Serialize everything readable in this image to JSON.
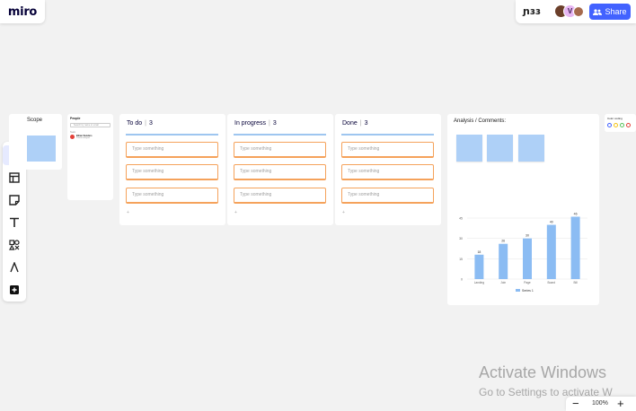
{
  "app": {
    "logo": "miro"
  },
  "top_bar": {
    "reactions": "ɲɜɜ",
    "avatar_initial": "V",
    "share_label": "Share"
  },
  "frames": {
    "scope": {
      "title": "Scope"
    },
    "people": {
      "title": "People",
      "search_placeholder": "Search by name or email",
      "subheading": "Team",
      "member_name": "Ethan Sanders",
      "member_role": "Product designer"
    },
    "columns": [
      {
        "title": "To do",
        "count": "3",
        "tasks": [
          "Type something",
          "Type something",
          "Type something"
        ],
        "add": "+"
      },
      {
        "title": "In progress",
        "count": "3",
        "tasks": [
          "Type something",
          "Type something",
          "Type something"
        ],
        "add": "+"
      },
      {
        "title": "Done",
        "count": "3",
        "tasks": [
          "Type something",
          "Type something",
          "Type something"
        ],
        "add": "+"
      }
    ],
    "analysis": {
      "title": "Analysis / Comments:"
    },
    "color_coding": {
      "title": "Color coding"
    }
  },
  "colors": {
    "accent": "#4262ff",
    "sticky": "#aed0f7",
    "task_border": "#f5a25b",
    "bar": "#8bbcf3",
    "dots": [
      "#4262ff",
      "#f5c518",
      "#58c25c",
      "#e3413a"
    ]
  },
  "chart_data": {
    "type": "bar",
    "categories": [
      "Landing",
      "Join",
      "Page",
      "Board",
      "Bill"
    ],
    "series": [
      {
        "name": "Series 1",
        "values": [
          18,
          26,
          30,
          40,
          46
        ]
      }
    ],
    "data_labels": [
      "18",
      "26",
      "30",
      "40",
      "46"
    ],
    "yticks": [
      "0",
      "15",
      "30",
      "45"
    ],
    "ylim": [
      0,
      45
    ],
    "legend": "bottom",
    "grid": true
  },
  "zoom": {
    "minus": "−",
    "value": "100%",
    "plus": "+"
  },
  "watermark": {
    "line1": "Activate Windows",
    "line2": "Go to Settings to activate W"
  }
}
